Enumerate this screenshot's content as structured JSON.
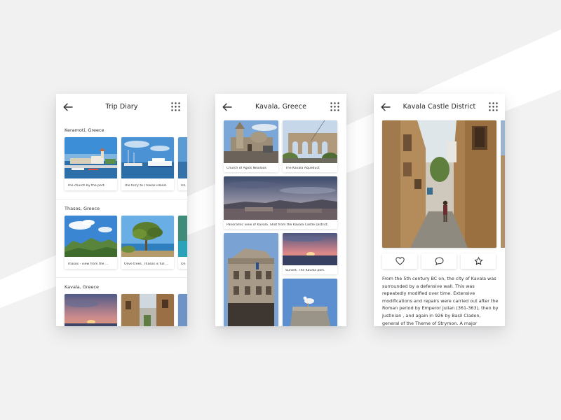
{
  "screens": {
    "trip_diary": {
      "title": "Trip Diary",
      "back_icon": "arrow-left-icon",
      "menu_icon": "grid-dots-icon",
      "sections": [
        {
          "label": "Keramoti, Greece",
          "captions": [
            "The church by the port.",
            "The ferry to Thasos island.",
            "On"
          ]
        },
        {
          "label": "Thasos, Greece",
          "captions": [
            "Thasos - view from the ...",
            "Olive trees. Thasos is full ...",
            "On"
          ]
        },
        {
          "label": "Kavala, Greece",
          "captions": [
            "",
            "",
            ""
          ]
        }
      ]
    },
    "kavala": {
      "title": "Kavala, Greece",
      "captions": {
        "church": "Church of Agios Nikolaos",
        "aqueduct": "The Kavala Aqueduct",
        "panorama": "Panoramic view of Kavala. Shot from the Kavala Castle District.",
        "sunset": "Sunset. The Kavala port."
      }
    },
    "castle": {
      "title": "Kavala Castle District",
      "actions": [
        "heart-icon",
        "comment-icon",
        "star-icon"
      ],
      "article": "From the 5th century BC on, the city of Kavala was surrounded by a defensive wall. This was repeatedly modified over time. Extensive modifications and repairs were carried out after the Roman period by Emperor Julian (361-363), then by Justinian , and again in 926 by Basil Cladon, general of the Theme of Strymon. A major"
    }
  },
  "colors": {
    "background": "#f1f1f2",
    "card": "#ffffff",
    "text": "#222222",
    "icon": "#333333"
  }
}
